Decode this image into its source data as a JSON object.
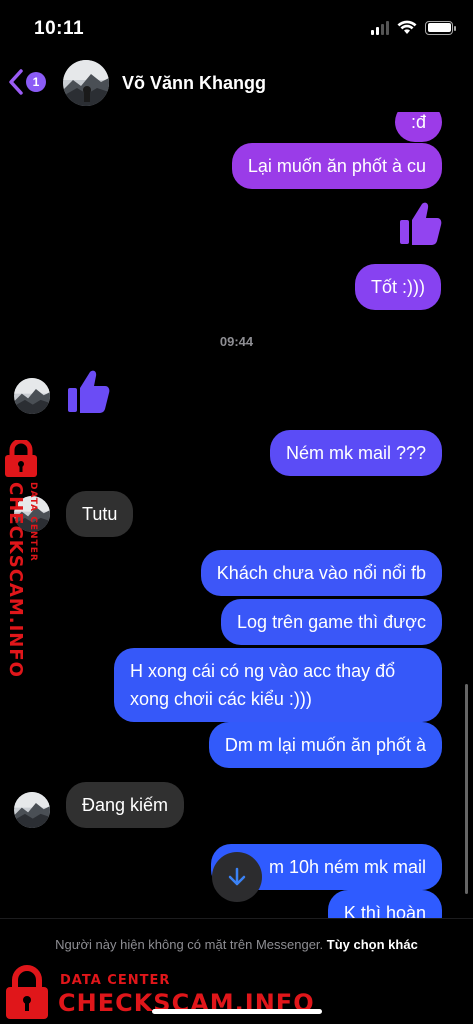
{
  "status_bar": {
    "time": "10:11"
  },
  "header": {
    "back_badge": "1",
    "contact_name": "Võ Vănn Khangg"
  },
  "messages": {
    "m1": ":đ",
    "m2": "Lại muốn ăn phốt à cu",
    "m3": "Tốt :)))",
    "timestamp": "09:44",
    "m4": "Ném mk mail ???",
    "m5": "Tutu",
    "m6": "Khách chưa vào nổi nổi fb",
    "m7": "Log trên game thì được",
    "m8": "H xong cái có ng vào acc thay đổ xong chơii các kiểu :)))",
    "m9": "Dm m lại muốn ăn phốt à",
    "m10": "Đang kiếm",
    "m11": "m 10h ném mk mail",
    "m12": "K thì hoàn"
  },
  "footer": {
    "notice": "Người này hiện không có mặt trên Messenger.",
    "action": "Tùy chọn khác"
  },
  "watermark": {
    "small": "DATA CENTER",
    "big": "CHECKSCAM.INFO"
  },
  "colors": {
    "bubble_gradient_top": "#9a3ce8",
    "bubble_gradient_bottom": "#2f5bff",
    "incoming_bubble": "#303030",
    "watermark_red": "#e0161a"
  },
  "icons": [
    "back-chevron-icon",
    "thumbs-up-icon",
    "arrow-down-icon",
    "lock-icon",
    "wifi-icon",
    "battery-icon",
    "signal-icon"
  ]
}
